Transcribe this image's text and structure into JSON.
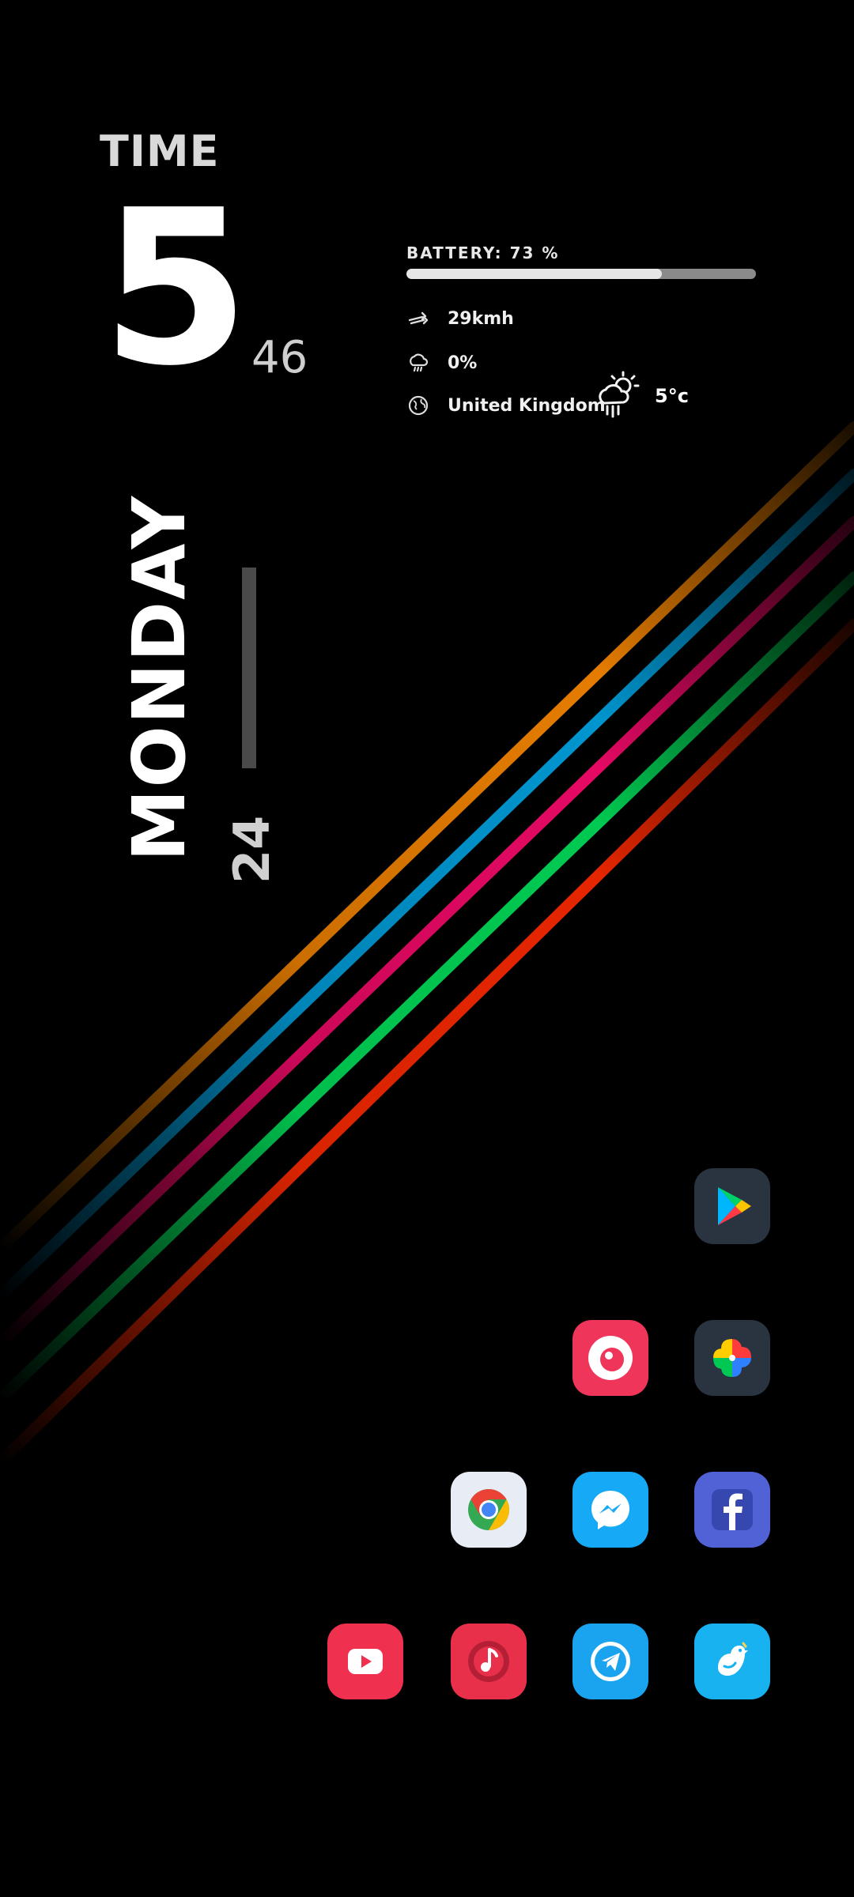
{
  "clock": {
    "label": "TIME",
    "hour": "5",
    "minute": "46",
    "day": "MONDAY",
    "date": "24"
  },
  "status": {
    "battery_label": "BATTERY: 73 %",
    "battery_level": 0.73,
    "wind": "29kmh",
    "rain": "0%",
    "location": "United Kingdom",
    "temperature": "5°c"
  },
  "colors": {
    "stripes": [
      "#ff8a00",
      "#00a6e6",
      "#ff0a6e",
      "#00e05a",
      "#ff2a00"
    ],
    "battery_fill": "#e6e6e6",
    "battery_track": "#8a8a8a"
  },
  "apps": [
    {
      "icon": "play-store-icon"
    },
    {
      "icon": "screen-recorder-icon"
    },
    {
      "icon": "photos-icon"
    },
    {
      "icon": "chrome-icon"
    },
    {
      "icon": "messenger-icon"
    },
    {
      "icon": "facebook-icon"
    },
    {
      "icon": "youtube-icon"
    },
    {
      "icon": "music-icon"
    },
    {
      "icon": "telegram-icon"
    },
    {
      "icon": "twitter-icon"
    }
  ]
}
